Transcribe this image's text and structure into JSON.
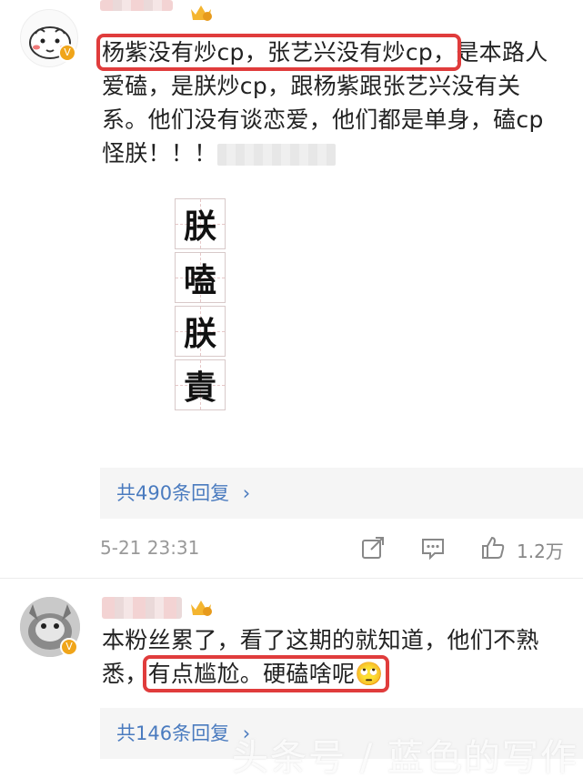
{
  "comments": [
    {
      "text_parts": {
        "highlight": "杨紫没有炒cp，张艺兴没有炒cp，",
        "rest": "是本路人爱磕，是朕炒cp，跟杨紫跟张艺兴没有关系。他们没有谈恋爱，他们都是单身，磕cp怪朕！！！"
      },
      "sticker_chars": [
        "朕",
        "嗑",
        "朕",
        "責"
      ],
      "replies_label": "共490条回复",
      "time": "5-21 23:31",
      "like_count": "1.2万"
    },
    {
      "text_parts": {
        "before": "本粉丝累了，看了这期的就知道，他们不熟悉，",
        "highlight": "有点尴尬。硬磕啥呢🙄"
      },
      "replies_label": "共146条回复"
    }
  ],
  "watermark": "头条号 / 蓝色的写作",
  "colors": {
    "highlight_border": "#e03c3c",
    "link": "#4a7bbf",
    "badge": "#f0a51a"
  }
}
